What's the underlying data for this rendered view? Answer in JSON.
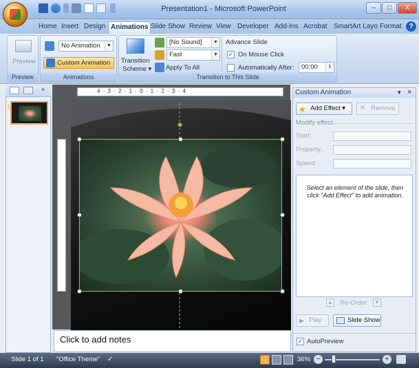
{
  "window": {
    "title": "Presentation1 - Microsoft PowerPoint",
    "controls": {
      "minimize": "–",
      "maximize": "□",
      "close": "X"
    }
  },
  "tabs": [
    {
      "label": "Home",
      "active": false
    },
    {
      "label": "Insert",
      "active": false
    },
    {
      "label": "Design",
      "active": false
    },
    {
      "label": "Animations",
      "active": true
    },
    {
      "label": "Slide Show",
      "active": false
    },
    {
      "label": "Review",
      "active": false
    },
    {
      "label": "View",
      "active": false
    },
    {
      "label": "Developer",
      "active": false
    },
    {
      "label": "Add-Ins",
      "active": false
    },
    {
      "label": "Acrobat",
      "active": false
    },
    {
      "label": "SmartArt Layo",
      "active": false
    },
    {
      "label": "Format",
      "active": false
    }
  ],
  "help_label": "?",
  "ribbon": {
    "preview_group": {
      "button": "Preview",
      "label": "Preview"
    },
    "animations_group": {
      "animate_value": "No Animation",
      "custom_animation": "Custom Animation",
      "label": "Animations"
    },
    "transition_group": {
      "scheme_line1": "Transition",
      "scheme_line2": "Scheme ▾",
      "sound_value": "[No Sound]",
      "speed_value": "Fast",
      "apply_all": "Apply To All",
      "label": "Transition to This Slide"
    },
    "advance_group": {
      "title": "Advance Slide",
      "on_mouse_click": "On Mouse Click",
      "on_mouse_click_checked": true,
      "auto_after": "Automatically After:",
      "auto_after_checked": false,
      "auto_time": "00:00"
    }
  },
  "slides_pane": {
    "slide_number": "1"
  },
  "ruler_text": "4 · 3 · 2 · 1 · 0 · 1 · 2 · 3 · 4",
  "notes_placeholder": "Click to add notes",
  "task_pane": {
    "title": "Custom Animation",
    "add_effect": "Add Effect ▾",
    "remove": "Remove",
    "modify_effect": "Modify effect",
    "start_label": "Start:",
    "property_label": "Property:",
    "speed_label": "Speed:",
    "message": "Select an element of the slide, then click \"Add Effect\" to add animation.",
    "reorder": "Re-Order",
    "play": "Play",
    "slide_show": "Slide Show",
    "autopreview": "AutoPreview",
    "autopreview_checked": true
  },
  "status": {
    "slide_info": "Slide 1 of 1",
    "theme": "\"Office Theme\"",
    "zoom": "36%"
  },
  "colors": {
    "accent_active": "#f4a63c",
    "ribbon": "#c7d8ef",
    "status_bar": "#2d3a4f"
  }
}
